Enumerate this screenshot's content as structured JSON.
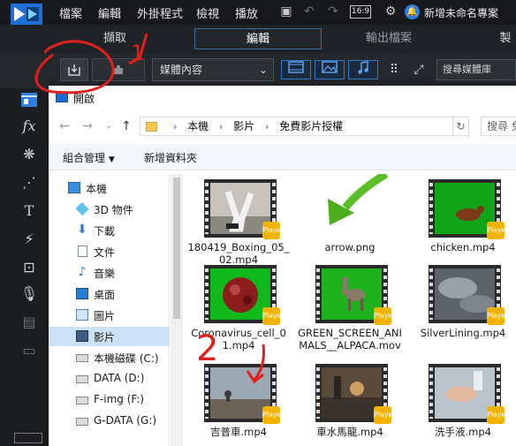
{
  "menubar": {
    "items": [
      "檔案",
      "編輯",
      "外掛程式",
      "檢視",
      "播放"
    ],
    "aspect_ratio": "16:9",
    "project_title": "新增未命名專案"
  },
  "modes": {
    "tabs": [
      {
        "label": "擷取"
      },
      {
        "label": "編輯"
      },
      {
        "label": "輸出檔案"
      },
      {
        "label": "製"
      }
    ]
  },
  "library": {
    "dropdown_value": "媒體內容",
    "search_placeholder": "搜尋媒體庫"
  },
  "sidebar": {
    "icons": [
      "media-room-icon",
      "fx-icon",
      "particle-icon",
      "particle-spray-icon",
      "title-icon",
      "transition-icon",
      "pip-icon",
      "audio-mixing-icon",
      "subtitle-icon",
      "chapter-icon"
    ],
    "labels": {
      "fx": "fx",
      "title": "T"
    }
  },
  "dialog": {
    "title": "開啟",
    "breadcrumb": [
      "本機",
      "影片",
      "免費影片授權"
    ],
    "search_placeholder": "搜尋 免",
    "organize_label": "組合管理",
    "new_folder_label": "新增資料夾",
    "nav_items": [
      {
        "label": "本機",
        "icon": "pc-icon"
      },
      {
        "label": "3D 物件",
        "icon": "3d-objects-icon"
      },
      {
        "label": "下載",
        "icon": "download-icon"
      },
      {
        "label": "文件",
        "icon": "document-icon"
      },
      {
        "label": "音樂",
        "icon": "music-icon"
      },
      {
        "label": "桌面",
        "icon": "desktop-icon"
      },
      {
        "label": "圖片",
        "icon": "pictures-icon"
      },
      {
        "label": "影片",
        "icon": "videos-icon"
      },
      {
        "label": "本機磁碟 (C:)",
        "icon": "drive-icon"
      },
      {
        "label": "DATA (D:)",
        "icon": "drive-icon"
      },
      {
        "label": "F-img (F:)",
        "icon": "drive-icon"
      },
      {
        "label": "G-DATA (G:)",
        "icon": "drive-icon"
      }
    ],
    "files": [
      {
        "name": "180419_Boxing_05_02.mp4",
        "kind": "video",
        "badge": "Player"
      },
      {
        "name": "arrow.png",
        "kind": "image",
        "badge": ""
      },
      {
        "name": "chicken.mp4",
        "kind": "video",
        "badge": "Player"
      },
      {
        "name": "Coronavirus_cell_01.mp4",
        "kind": "video",
        "badge": "Player"
      },
      {
        "name": "GREEN_SCREEN_ANIMALS__ALPACA.mov",
        "kind": "video",
        "badge": "Player"
      },
      {
        "name": "SilverLining.mp4",
        "kind": "video",
        "badge": "Player"
      },
      {
        "name": "吉普車.mp4",
        "kind": "video",
        "badge": "Player"
      },
      {
        "name": "車水馬龍.mp4",
        "kind": "video",
        "badge": "Player"
      },
      {
        "name": "洗手液.mp4",
        "kind": "video",
        "badge": "Player"
      }
    ]
  },
  "annotations": {
    "mark_1": "1",
    "mark_2": "2"
  },
  "colors": {
    "accent": "#2f78c8",
    "annotation": "#e0201c",
    "badge": "#f2b300"
  }
}
